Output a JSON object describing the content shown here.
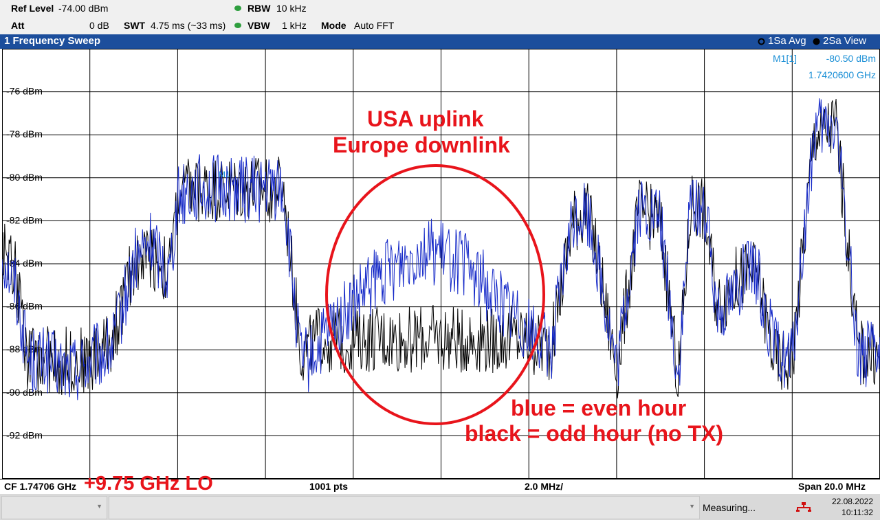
{
  "header": {
    "ref_level_label": "Ref Level",
    "ref_level_value": "-74.00 dBm",
    "att_label": "Att",
    "att_value": "0 dB",
    "swt_label": "SWT",
    "swt_value": "4.75 ms (~33 ms)",
    "rbw_label": "RBW",
    "rbw_value": "10 kHz",
    "vbw_label": "VBW",
    "vbw_value": "1 kHz",
    "mode_label": "Mode",
    "mode_value": "Auto FFT"
  },
  "window": {
    "title": "1 Frequency Sweep",
    "trace1": "1Sa Avg",
    "trace2": "2Sa View"
  },
  "marker": {
    "name": "M1[1]",
    "level": "-80.50 dBm",
    "freq": "1.7420600 GHz",
    "label": "M1"
  },
  "footer": {
    "cf": "CF 1.74706 GHz",
    "pts": "1001 pts",
    "div": "2.0 MHz/",
    "span": "Span 20.0 MHz"
  },
  "status": {
    "measuring": "Measuring...",
    "date": "22.08.2022",
    "time": "10:11:32"
  },
  "annotations": {
    "circle_line1": "USA uplink",
    "circle_line2": "Europe downlink",
    "legend_blue": "blue = even hour",
    "legend_black": "black = odd hour (no TX)",
    "lo": "+9.75 GHz LO"
  },
  "colors": {
    "blue_trace": "#1428c8",
    "black_trace": "#000000",
    "annotation": "#e8141b",
    "titlebar": "#1c4e9c",
    "marker_text": "#1a8fd6"
  },
  "chart_data": {
    "type": "line",
    "title": "1 Frequency Sweep",
    "xlabel": "",
    "ylabel": "",
    "x_range_GHz": [
      1.73706,
      1.75706
    ],
    "ylim": [
      -94.0,
      -74.0
    ],
    "y_ticks": [
      -76,
      -78,
      -80,
      -82,
      -84,
      -86,
      -88,
      -90,
      -92
    ],
    "y_tick_labels": [
      "-76 dBm",
      "-78 dBm",
      "-80 dBm",
      "-82 dBm",
      "-84 dBm",
      "-86 dBm",
      "-88 dBm",
      "-90 dBm",
      "-92 dBm"
    ],
    "grid": true,
    "series": [
      {
        "name": "blue = even hour",
        "color": "#1428c8",
        "x_MHz_offset": [
          -10,
          -9.7,
          -9.4,
          -9,
          -8.5,
          -8,
          -7.5,
          -7,
          -6.6,
          -6.2,
          -6.0,
          -5.8,
          -5.5,
          -5,
          -4.5,
          -4,
          -3.6,
          -3.2,
          -3.0,
          -2.8,
          -2.5,
          -2,
          -1.5,
          -1,
          -0.5,
          0,
          0.5,
          1,
          1.5,
          2,
          2.5,
          3,
          3.3,
          3.5,
          4,
          4.5,
          5,
          5.4,
          5.7,
          6.0,
          6.3,
          6.6,
          6.9,
          7.2,
          7.6,
          8,
          8.5,
          9,
          9.5,
          10
        ],
        "values_dBm": [
          -83.5,
          -85,
          -88.5,
          -88.5,
          -89,
          -88.5,
          -88,
          -84,
          -83,
          -84.5,
          -81,
          -80.5,
          -80.5,
          -80.5,
          -80.5,
          -80.5,
          -80.5,
          -88.5,
          -88.5,
          -88,
          -87,
          -86,
          -84.8,
          -84,
          -83.3,
          -83.5,
          -84,
          -85,
          -86,
          -87,
          -88,
          -82,
          -81.5,
          -83,
          -89,
          -81.5,
          -82,
          -89.5,
          -81,
          -81.5,
          -86,
          -85.5,
          -84.5,
          -84.5,
          -88,
          -88.5,
          -78,
          -77.5,
          -88,
          -88.5
        ]
      },
      {
        "name": "black = odd hour (no TX)",
        "color": "#000000",
        "x_MHz_offset": [
          -10,
          -9.7,
          -9.4,
          -9,
          -8.5,
          -8,
          -7.5,
          -7,
          -6.6,
          -6.2,
          -6.0,
          -5.8,
          -5.5,
          -5,
          -4.5,
          -4,
          -3.6,
          -3.2,
          -3.0,
          -2.8,
          -2.5,
          -2,
          -1.5,
          -1,
          -0.5,
          0,
          0.5,
          1,
          1.5,
          2,
          2.5,
          3,
          3.3,
          3.5,
          4,
          4.5,
          5,
          5.4,
          5.7,
          6.0,
          6.3,
          6.6,
          6.9,
          7.2,
          7.6,
          8,
          8.5,
          9,
          9.5,
          10
        ],
        "values_dBm": [
          -83,
          -84.5,
          -88.5,
          -88.5,
          -88.5,
          -88.5,
          -87.5,
          -84,
          -83.5,
          -84.5,
          -81,
          -80.5,
          -80.5,
          -80.5,
          -80.5,
          -80.5,
          -80.5,
          -88,
          -88,
          -87.5,
          -87.5,
          -87.5,
          -87.5,
          -87.5,
          -87.5,
          -87.5,
          -87.5,
          -87.5,
          -87.5,
          -87.5,
          -88,
          -82,
          -81.5,
          -83,
          -89,
          -81.5,
          -82,
          -89.5,
          -81,
          -81.5,
          -86,
          -85,
          -84.5,
          -84.5,
          -88.5,
          -88.5,
          -78,
          -77.5,
          -88,
          -88.5
        ]
      }
    ]
  }
}
